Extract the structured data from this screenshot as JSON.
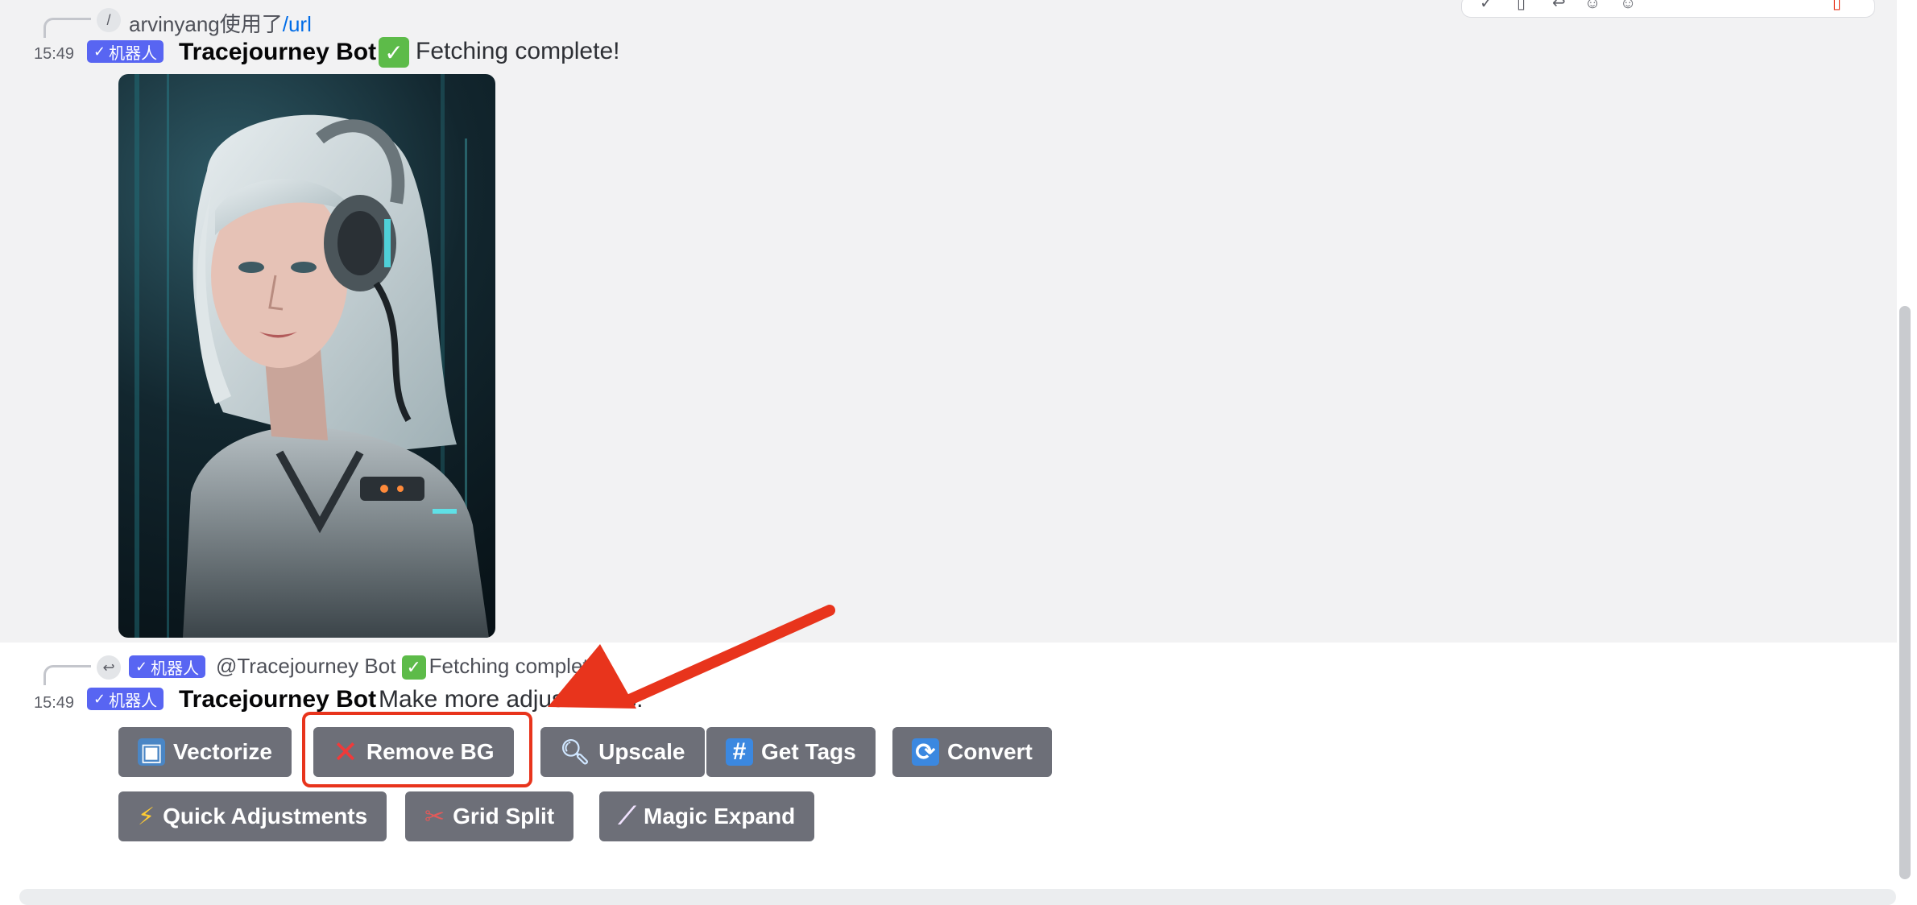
{
  "message1": {
    "reply_user": "arvinyang",
    "reply_action": "使用了",
    "reply_command": "/url",
    "reply_avatar_glyph": "/",
    "time": "15:49",
    "badge": "机器人",
    "username": "Tracejourney Bot",
    "content": "Fetching complete!"
  },
  "message2": {
    "reply_badge": "机器人",
    "reply_mention": "@Tracejourney Bot",
    "reply_content": "Fetching complete!",
    "time": "15:49",
    "badge": "机器人",
    "username": "Tracejourney Bot",
    "content": "Make more adjustments:"
  },
  "buttons_row1": [
    {
      "label": "Vectorize",
      "icon": "framed-picture-icon"
    },
    {
      "label": "Remove BG",
      "icon": "cross-mark-icon"
    },
    {
      "label": "Upscale",
      "icon": "magnifying-glass-icon"
    },
    {
      "label": "Get Tags",
      "icon": "hash-icon"
    },
    {
      "label": "Convert",
      "icon": "arrows-cycle-icon"
    }
  ],
  "buttons_row2": [
    {
      "label": "Quick Adjustments",
      "icon": "lightning-icon"
    },
    {
      "label": "Grid Split",
      "icon": "scissors-icon"
    },
    {
      "label": "Magic Expand",
      "icon": "magic-wand-icon"
    }
  ],
  "colors": {
    "badge": "#5865f2",
    "button": "#6d6f78",
    "annotation": "#e8341c",
    "check_emoji": "#5dbb49"
  }
}
